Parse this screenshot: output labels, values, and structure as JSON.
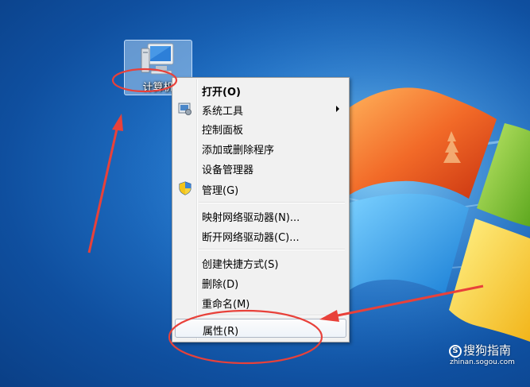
{
  "desktop": {
    "icon_label": "计算机"
  },
  "context_menu": {
    "items": [
      {
        "label": "打开(O)",
        "bold": true
      },
      {
        "label": "系统工具",
        "submenu": true,
        "icon": "system-tools-icon"
      },
      {
        "label": "控制面板"
      },
      {
        "label": "添加或删除程序"
      },
      {
        "label": "设备管理器"
      },
      {
        "label": "管理(G)",
        "icon": "uac-shield-icon"
      },
      {
        "label": "映射网络驱动器(N)..."
      },
      {
        "label": "断开网络驱动器(C)..."
      },
      {
        "label": "创建快捷方式(S)"
      },
      {
        "label": "删除(D)"
      },
      {
        "label": "重命名(M)"
      },
      {
        "label": "属性(R)",
        "selected": true
      }
    ]
  },
  "annotations": {
    "color": "#e8413a",
    "arrow_targets": [
      "计算机",
      "属性(R)"
    ]
  },
  "watermark": {
    "brand": "搜狗指南",
    "circle_glyph": "S",
    "url": "zhinan.sogou.com"
  },
  "colors": {
    "menu_bg": "#f1f1f1",
    "selected_border": "#aeb8c5",
    "annotation_red": "#e8413a"
  }
}
